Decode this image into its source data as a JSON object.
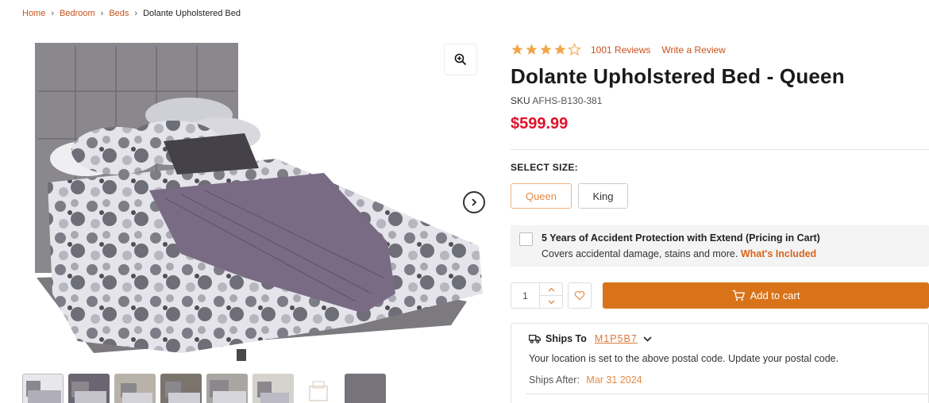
{
  "breadcrumb": {
    "items": [
      "Home",
      "Bedroom",
      "Beds"
    ],
    "current": "Dolante Upholstered Bed"
  },
  "product": {
    "rating": 4,
    "rating_max": 5,
    "reviews_link": "1001 Reviews",
    "write_review_link": "Write a Review",
    "title": "Dolante Upholstered Bed - Queen",
    "sku_label": "SKU",
    "sku": "AFHS-B130-381",
    "price": "$599.99"
  },
  "size": {
    "label": "SELECT SIZE:",
    "options": [
      "Queen",
      "King"
    ],
    "selected": "Queen"
  },
  "protection": {
    "title": "5 Years of Accident Protection with Extend (Pricing in Cart)",
    "subtitle": "Covers accidental damage, stains and more. ",
    "link": "What's Included"
  },
  "purchase": {
    "quantity": "1",
    "add_to_cart": "Add to cart"
  },
  "shipping": {
    "label": "Ships To",
    "postal_code": "M1P5B7",
    "location_message": "Your location is set to the above postal code. Update your postal code.",
    "ships_after_label": "Ships After:",
    "ships_after_date": "Mar 31 2024"
  },
  "colors": {
    "accent": "#d8731a",
    "link": "#c8521c",
    "price": "#e0112b",
    "star": "#f0a64a"
  },
  "icons": {
    "zoom": "zoom-in-icon",
    "next": "chevron-right-circle-icon",
    "wishlist": "heart-icon",
    "cart": "cart-icon",
    "truck": "truck-icon"
  }
}
